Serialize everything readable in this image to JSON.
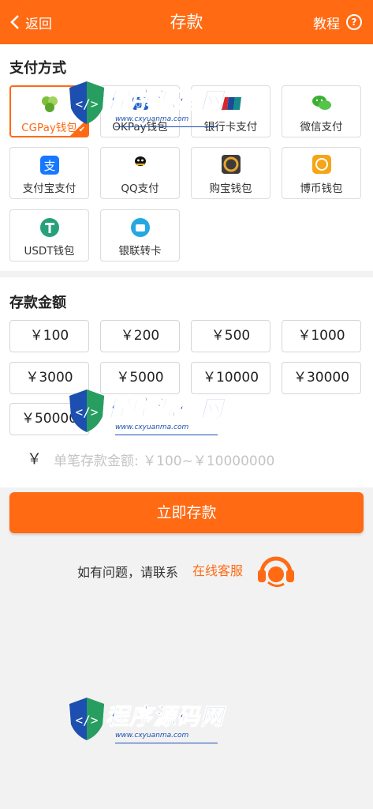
{
  "header": {
    "back_label": "返回",
    "title": "存款",
    "help_label": "教程",
    "help_icon": "?"
  },
  "payment": {
    "section_title": "支付方式",
    "methods": [
      {
        "label": "CGPay钱包",
        "icon": "cgpay-icon",
        "selected": true
      },
      {
        "label": "OKPay钱包",
        "icon": "okpay-icon",
        "selected": false
      },
      {
        "label": "银行卡支付",
        "icon": "unionpay-icon",
        "selected": false
      },
      {
        "label": "微信支付",
        "icon": "wechat-icon",
        "selected": false
      },
      {
        "label": "支付宝支付",
        "icon": "alipay-icon",
        "selected": false
      },
      {
        "label": "QQ支付",
        "icon": "qq-icon",
        "selected": false
      },
      {
        "label": "购宝钱包",
        "icon": "goubao-icon",
        "selected": false
      },
      {
        "label": "博币钱包",
        "icon": "bobi-icon",
        "selected": false
      },
      {
        "label": "USDT钱包",
        "icon": "usdt-icon",
        "selected": false
      },
      {
        "label": "银联转卡",
        "icon": "bank-transfer-icon",
        "selected": false
      }
    ]
  },
  "deposit": {
    "section_title": "存款金额",
    "amounts": [
      "￥100",
      "￥200",
      "￥500",
      "￥1000",
      "￥3000",
      "￥5000",
      "￥10000",
      "￥30000",
      "￥50000"
    ],
    "currency_symbol": "￥",
    "placeholder": "单笔存款金额: ￥100~￥10000000"
  },
  "submit_label": "立即存款",
  "contact": {
    "text": "如有问题，请联系",
    "link": "在线客服"
  },
  "watermark": {
    "text": "程序源码网",
    "url": "www.cxyuanma.com"
  },
  "colors": {
    "accent": "#ff6a13",
    "watermark": "#1c4fb0"
  }
}
